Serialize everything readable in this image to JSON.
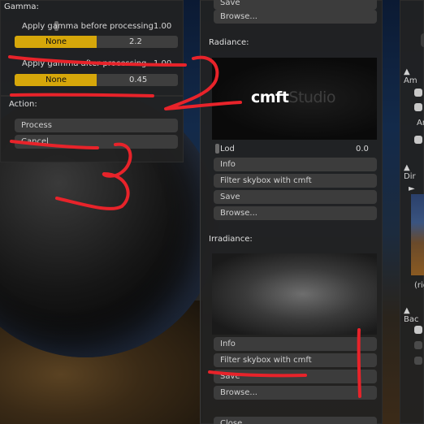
{
  "gamma": {
    "title": "Gamma:",
    "before_label": "Apply gamma before processing",
    "before_value": "1.00",
    "before_select": "None",
    "before_select_value": "2.2",
    "after_label": "Apply gamma after processing",
    "after_value": "1.00",
    "after_select": "None",
    "after_select_value": "0.45"
  },
  "action": {
    "title": "Action:",
    "process_label": "Process",
    "cancel_label": "Cancel"
  },
  "top_buttons": {
    "save_label": "Save",
    "browse_label": "Browse..."
  },
  "radiance": {
    "title": "Radiance:",
    "logo_part1": "cmft",
    "logo_part2": "Studio",
    "lod_label": "Lod",
    "lod_value": "0.0",
    "info_label": "Info",
    "filter_label": "Filter skybox with cmft",
    "save_label": "Save",
    "browse_label": "Browse..."
  },
  "irradiance": {
    "title": "Irradiance:",
    "info_label": "Info",
    "filter_label": "Filter skybox with cmft",
    "save_label": "Save",
    "browse_label": "Browse..."
  },
  "bottom": {
    "close_label": "Close"
  },
  "right_panel": {
    "amb_header": "Am",
    "amb_item": "Am",
    "dir_header": "Dir",
    "caption": "(rig",
    "bac_header": "Bac"
  },
  "annotations": {
    "label_2": "2",
    "label_3": "3"
  },
  "colors": {
    "accent": "#d6a70a",
    "panel_bg": "#222222",
    "button_bg": "#3c3c3c",
    "annotation_red": "#e8232a"
  }
}
